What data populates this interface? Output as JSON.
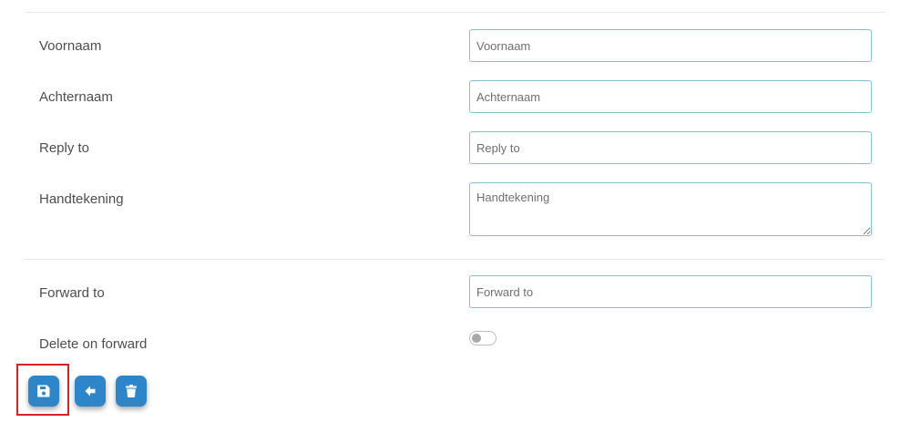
{
  "form": {
    "first_name": {
      "label": "Voornaam",
      "placeholder": "Voornaam"
    },
    "last_name": {
      "label": "Achternaam",
      "placeholder": "Achternaam"
    },
    "reply_to": {
      "label": "Reply to",
      "placeholder": "Reply to"
    },
    "signature": {
      "label": "Handtekening",
      "placeholder": "Handtekening"
    },
    "forward_to": {
      "label": "Forward to",
      "placeholder": "Forward to"
    },
    "delete_on_forward": {
      "label": "Delete on forward",
      "enabled": false
    }
  },
  "toolbar": {
    "buttons": [
      {
        "name": "save",
        "icon": "floppy-disk-icon"
      },
      {
        "name": "back",
        "icon": "arrow-left-icon"
      },
      {
        "name": "delete",
        "icon": "trash-icon"
      }
    ]
  },
  "colors": {
    "accent": "#2d86c9",
    "field_border": "#7fc4cf",
    "highlight": "#e02020"
  }
}
